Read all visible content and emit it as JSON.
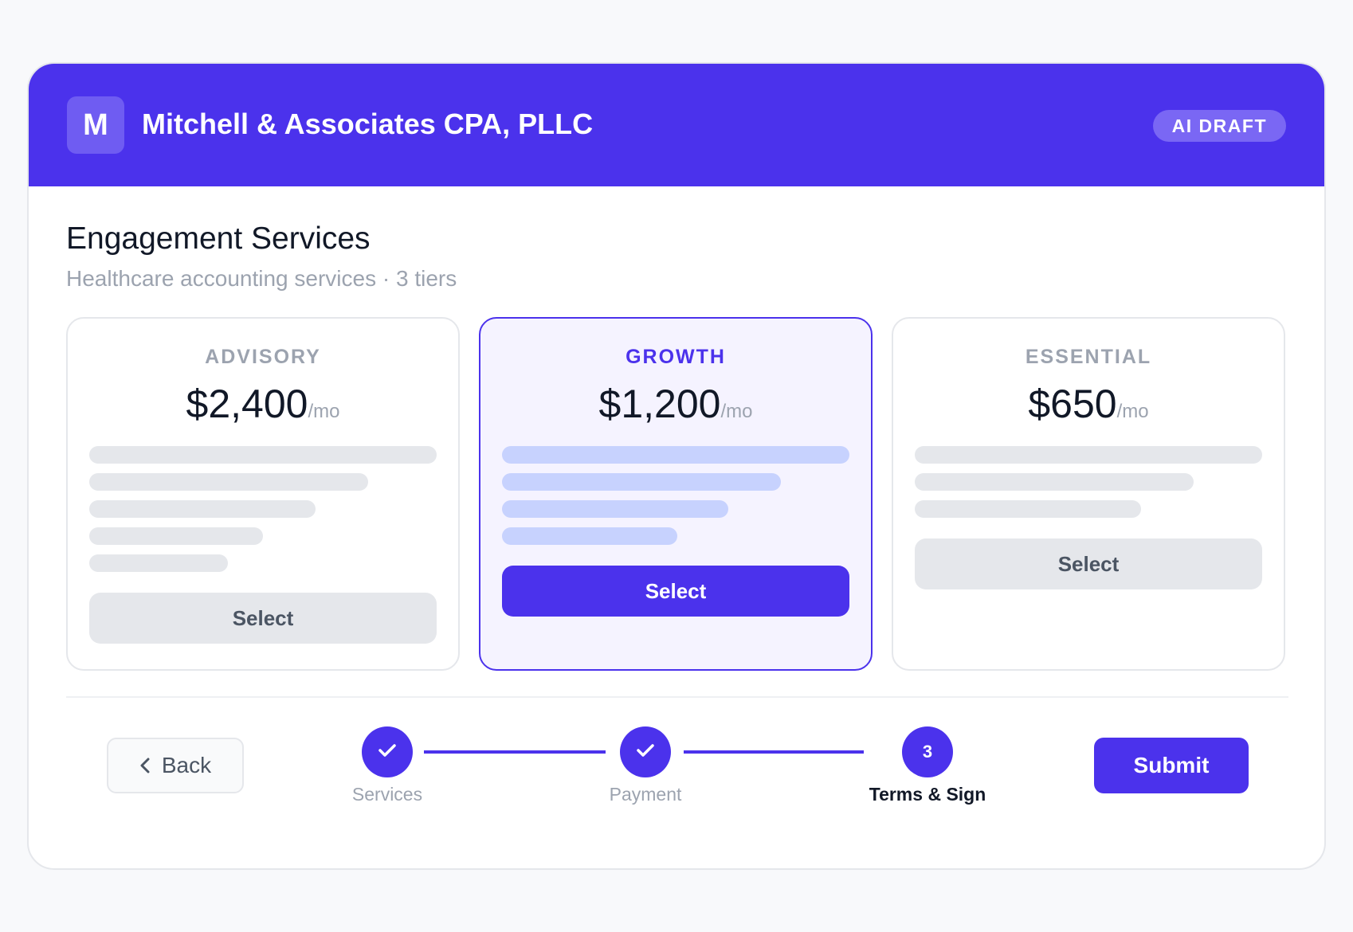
{
  "header": {
    "logo_letter": "M",
    "firm_name": "Mitchell & Associates CPA, PLLC",
    "badge": "AI DRAFT"
  },
  "section": {
    "title": "Engagement Services",
    "subtitle": "Healthcare accounting services · 3 tiers"
  },
  "tiers": [
    {
      "name": "ADVISORY",
      "price": "$2,400",
      "unit": "/mo",
      "select_label": "Select",
      "featured": false
    },
    {
      "name": "GROWTH",
      "price": "$1,200",
      "unit": "/mo",
      "select_label": "Select",
      "featured": true
    },
    {
      "name": "ESSENTIAL",
      "price": "$650",
      "unit": "/mo",
      "select_label": "Select",
      "featured": false
    }
  ],
  "footer": {
    "back_label": "Back",
    "submit_label": "Submit",
    "steps": [
      {
        "label": "Services",
        "state": "complete",
        "icon": "check-icon"
      },
      {
        "label": "Payment",
        "state": "complete",
        "icon": "check-icon"
      },
      {
        "label": "Terms & Sign",
        "state": "active",
        "number": "3"
      }
    ]
  },
  "colors": {
    "accent": "#4b32ec",
    "placeholder_bar": "#e5e7eb",
    "featured_bar": "#c7d2fe",
    "featured_bg": "#f5f3ff"
  }
}
